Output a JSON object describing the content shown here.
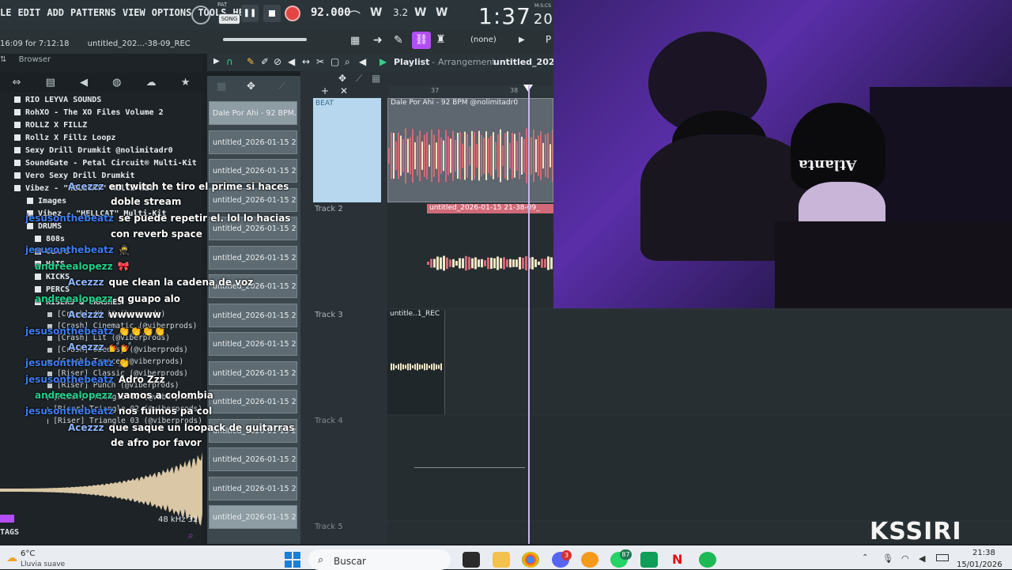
{
  "fl": {
    "menus": [
      "LE",
      "EDIT",
      "ADD",
      "PATTERNS",
      "VIEW",
      "OPTIONS",
      "TOOLS",
      "HELP"
    ],
    "pat_label": "PAT",
    "song_label": "SONG",
    "bpm": "92.000",
    "time_big": "1:37",
    "time_small": "20",
    "time_unit": "M:S:CS",
    "hint": "16:09 for 7:12:18",
    "project_name": "untitled_202...-38-09_REC",
    "snap_label": "(none)",
    "play_mode": "P"
  },
  "browser": {
    "title": "Browser",
    "items": [
      "RIO LEYVA SOUNDS",
      "RohXO - The XO Files Volume 2",
      "ROLLZ X FILLZ",
      "Rollz X Fillz Loopz",
      "Sexy Drill Drumkit @nolimitadr0",
      "SoundGate - Petal Circuit® Multi-Kit",
      "Vero Sexy Drill Drumkit",
      "Vibez - \"HELLCAT\" Multi-Kit",
      "Images",
      "Vibez - \"HELLCAT\" Multi-Kit",
      "DRUMS",
      "808s",
      "CLAPS",
      "HATS",
      "KICKS",
      "PERCS",
      "RISERS & CRASHES",
      "[Crash] 4K (@viberprods)",
      "[Crash] Cinematic (@viberprods)",
      "[Crash] Lit (@viberprods)",
      "[Crash] Obeeesy (@viberprods)",
      "[Crash] Trance (@viberprods)",
      "[Riser] Classic (@viberprods)",
      "[Riser] Punch (@viberprods)",
      "[Riser] Triangle 01 (@viberprods)",
      "[Riser] Triangle 02 (@viberprods)",
      "[Riser] Triangle 03 (@viberprods)"
    ],
    "sample_rate": "48 kHz 32",
    "tags_label": "TAGS"
  },
  "playlist": {
    "title": "Playlist",
    "subtitle": "Arrangement",
    "project": "untitled_2026-",
    "ruler_marks": [
      "37",
      "38"
    ],
    "patterns": [
      "Dale Por Ahi - 92 BPM..",
      "untitled_2026-01-15 21-..",
      "untitled_2026-01-15 21-..",
      "untitled_2026-01-15 21-..",
      "untitled_2026-01-15 21-..",
      "untitled_2026-01-15 21-..",
      "untitled_2026-01-15 21-..",
      "untitled_2026-01-15 21-..",
      "untitled_2026-01-15 21-..",
      "untitled_2026-01-15 21-..",
      "untitled_2026-01-15 21-..",
      "untitled_2026-01-15 21-..",
      "untitled_2026-01-15 21-..",
      "untitled_2026-01-15 21-..",
      "untitled_2026-01-15 21-.."
    ],
    "tracks": [
      {
        "name": "BEAT",
        "clip": "Dale Por Ahi - 92 BPM @nolimitadr0"
      },
      {
        "name": "Track 2",
        "clip": "untitled_2026-01-15 21-38-09_"
      },
      {
        "name": "Track 3",
        "clip": "untitle..1_REC"
      },
      {
        "name": "Track 4",
        "clip": ""
      },
      {
        "name": "Track 5",
        "clip": ""
      }
    ]
  },
  "chat": [
    {
      "user": "Acezzz",
      "msg": "en twitch te tiro el prime si haces",
      "color": "#8fb4ff"
    },
    {
      "user": "",
      "msg": "doble stream",
      "color": "#8fb4ff"
    },
    {
      "user": "jesusonthebeatz",
      "msg": "se puede repetir el. lol lo hacias",
      "color": "#3c7cf0"
    },
    {
      "user": "",
      "msg": "con reverb space",
      "color": "#3c7cf0"
    },
    {
      "user": "jesusonthebeatz",
      "msg": "🥷",
      "color": "#3c7cf0"
    },
    {
      "user": "andreealopezz",
      "msg": "🎀",
      "color": "#1fd28a"
    },
    {
      "user": "Acezzz",
      "msg": "que clean la cadena de voz",
      "color": "#8fb4ff"
    },
    {
      "user": "andreealopezz",
      "msg": "q guapo alo",
      "color": "#1fd28a"
    },
    {
      "user": "Acezzz",
      "msg": "wwwwww",
      "color": "#8fb4ff"
    },
    {
      "user": "jesusonthebeatz",
      "msg": "👏👏👏👏",
      "color": "#3c7cf0"
    },
    {
      "user": "Acezzz",
      "msg": "💅💅",
      "color": "#8fb4ff"
    },
    {
      "user": "jesusonthebeatz",
      "msg": "👏",
      "color": "#3c7cf0"
    },
    {
      "user": "jesusonthebeatz",
      "msg": "Adro Zzz",
      "color": "#3c7cf0"
    },
    {
      "user": "andreealopezz",
      "msg": "vamos a colombia",
      "color": "#1fd28a"
    },
    {
      "user": "jesusonthebeatz",
      "msg": "nos fuimos pa col",
      "color": "#3c7cf0"
    },
    {
      "user": "Acezzz",
      "msg": "que saque un loopack de guitarras",
      "color": "#8fb4ff"
    },
    {
      "user": "",
      "msg": "de afro por favor",
      "color": "#8fb4ff"
    }
  ],
  "stream": {
    "logo": "KSSIRI",
    "cap_text_1": "★",
    "cap_text_2": "Atlanta"
  },
  "taskbar": {
    "temp": "6°C",
    "weather": "Lluvia suave",
    "search": "Buscar",
    "badge_1": "3",
    "badge_2": "87",
    "time": "21:38",
    "date": "15/01/2026"
  },
  "colors": {
    "accent_pink": "#d06a78",
    "clip_cream": "#f1e6c3",
    "twitch_purple": "#b34ef2",
    "webcam_purple": "#5a2ea8"
  }
}
